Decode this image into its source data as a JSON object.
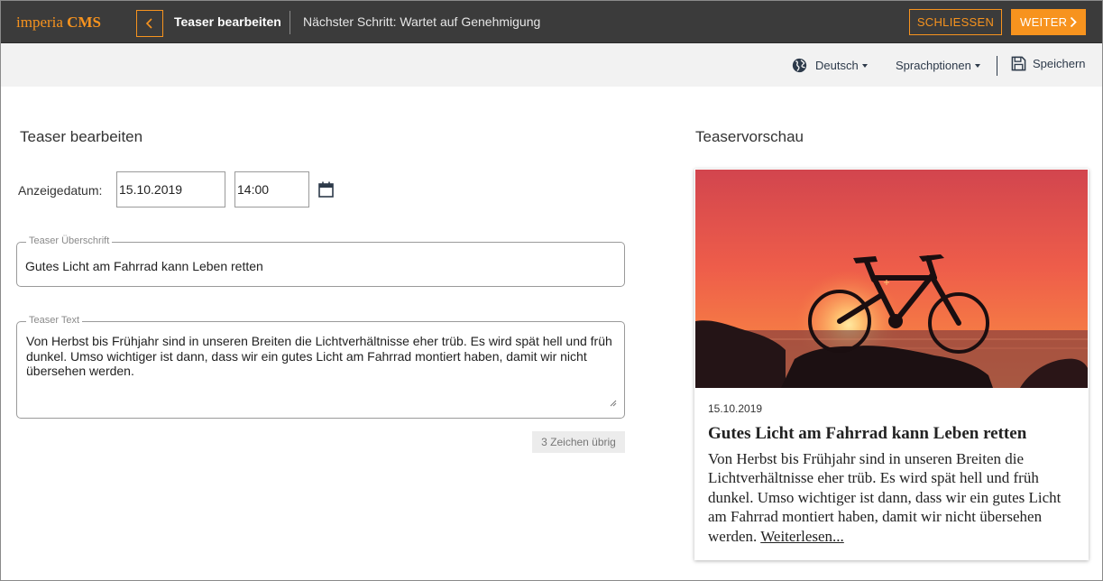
{
  "app": {
    "logo_light": "imperia",
    "logo_bold": "CMS"
  },
  "header": {
    "title": "Teaser bearbeiten",
    "next_step": "Nächster Schritt: Wartet auf Genehmigung",
    "close_label": "SCHLIESSEN",
    "next_label": "WEITER"
  },
  "toolbar": {
    "language_label": "Deutsch",
    "language_options_label": "Sprachptionen",
    "save_label": "Speichern",
    "icons": [
      "globe-icon",
      "caret-down-icon",
      "save-icon"
    ]
  },
  "editor": {
    "title": "Teaser bearbeiten",
    "date_label": "Anzeigedatum:",
    "date_value": "15.10.2019",
    "time_value": "14:00",
    "heading_legend": "Teaser Überschrift",
    "heading_value": "Gutes Licht am Fahrrad kann Leben retten",
    "text_legend": "Teaser Text",
    "text_value": "Von Herbst bis Frühjahr sind in unseren Breiten die Lichtverhältnisse eher trüb. Es wird spät hell und früh dunkel. Umso wichtiger ist dann, dass wir ein gutes Licht am Fahrrad montiert haben, damit wir nicht übersehen werden.",
    "chars_left": "3 Zeichen übrig"
  },
  "preview": {
    "title": "Teaservorschau",
    "date": "15.10.2019",
    "heading": "Gutes Licht am Fahrrad kann Leben retten",
    "text": "Von Herbst bis Frühjahr sind in unseren Breiten die Lichtverhältnisse eher trüb. Es wird spät hell und früh dunkel. Umso wichtiger ist dann, dass wir ein gutes Licht am Fahrrad montiert haben, damit wir nicht übersehen werden.",
    "read_more": "Weiterlesen..."
  },
  "colors": {
    "accent": "#f7931e",
    "topbar": "#3b3b3b",
    "toolbar": "#f2f2f2"
  }
}
